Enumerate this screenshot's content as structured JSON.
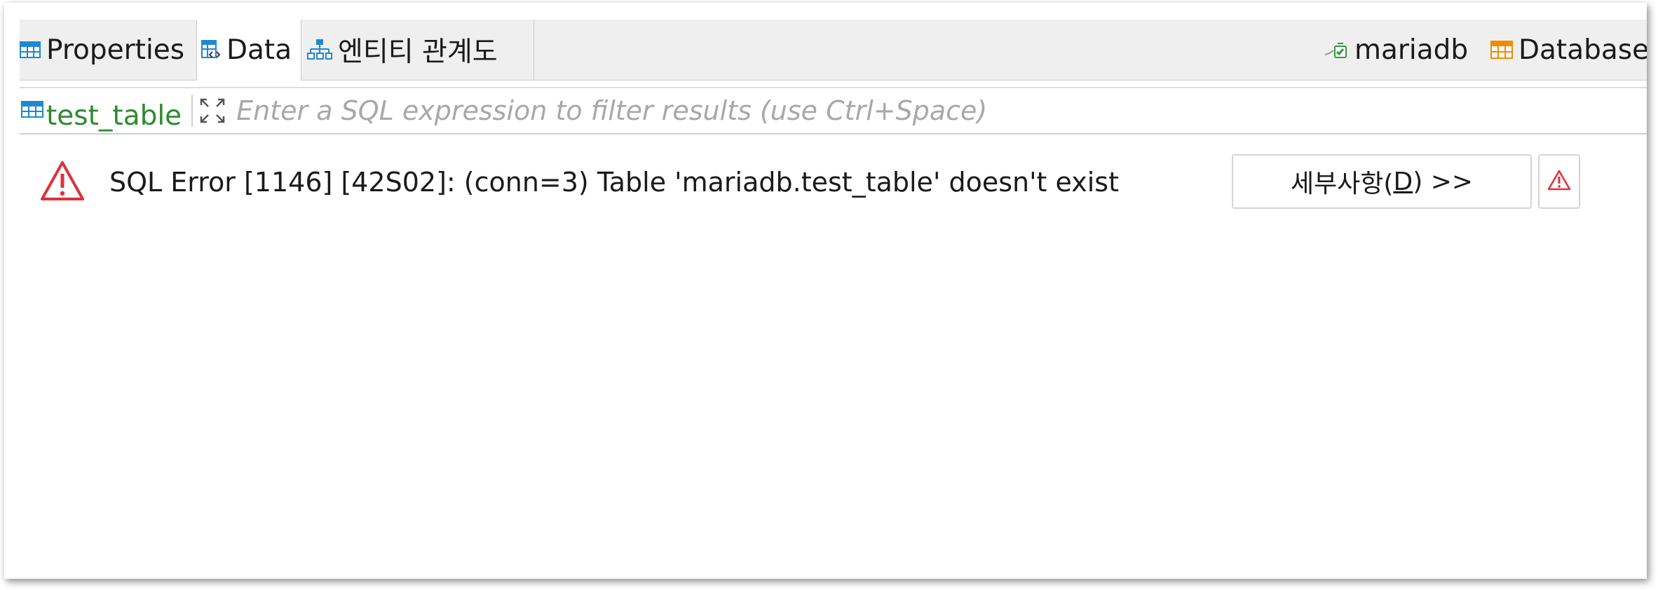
{
  "tabs": {
    "properties_label": "Properties",
    "data_label": "Data",
    "er_label": "엔티티 관계도",
    "connection_label": "mariadb",
    "database_label": "Database"
  },
  "filter": {
    "entity_name": "test_table",
    "placeholder": "Enter a SQL expression to filter results (use Ctrl+Space)"
  },
  "error": {
    "message": "SQL Error [1146] [42S02]: (conn=3) Table 'mariadb.test_table' doesn't exist",
    "details_label_prefix": "세부사항(",
    "details_mnemonic": "D",
    "details_label_suffix": ") >>"
  },
  "colors": {
    "entity_name": "#2e8b2e",
    "error_icon": "#e0303a",
    "table_icon": "#1e88d2",
    "database_icon": "#f08c00"
  },
  "icons": {
    "properties": "table-icon",
    "data": "data-grid-icon",
    "er": "er-diagram-icon",
    "connection": "connection-icon",
    "database": "database-icon",
    "entity": "table-icon",
    "expand": "expand-icon",
    "error": "warning-triangle-icon"
  }
}
